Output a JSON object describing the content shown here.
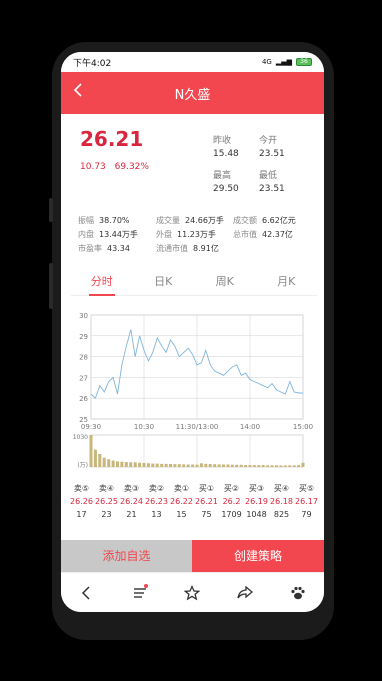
{
  "status_bar": {
    "time": "下午4:02",
    "network": "4G",
    "battery": "36"
  },
  "header": {
    "title": "N久盛",
    "back_icon": "chevron-left-icon"
  },
  "quote": {
    "price": "26.21",
    "change": "10.73",
    "change_pct": "69.32%",
    "prev_close_label": "昨收",
    "prev_close": "15.48",
    "open_label": "今开",
    "open": "23.51",
    "high_label": "最高",
    "high": "29.50",
    "low_label": "最低",
    "low": "23.51"
  },
  "stats": {
    "amplitude_label": "振幅",
    "amplitude": "38.70%",
    "volume_label": "成交量",
    "volume": "24.66万手",
    "turnover_label": "成交额",
    "turnover": "6.62亿元",
    "inner_label": "内盘",
    "inner": "13.44万手",
    "outer_label": "外盘",
    "outer": "11.23万手",
    "mktcap_label": "总市值",
    "mktcap": "42.37亿",
    "pe_label": "市盈率",
    "pe": "43.34",
    "float_cap_label": "流通市值",
    "float_cap": "8.91亿"
  },
  "tabs": [
    {
      "label": "分时",
      "active": true
    },
    {
      "label": "日K",
      "active": false
    },
    {
      "label": "周K",
      "active": false
    },
    {
      "label": "月K",
      "active": false
    }
  ],
  "chart_data": {
    "type": "line",
    "title": "",
    "xlabel": "",
    "ylabel": "",
    "x_ticks": [
      "09:30",
      "10:30",
      "11:30/13:00",
      "14:00",
      "15:00"
    ],
    "y_ticks": [
      "30",
      "29",
      "28",
      "27",
      "26",
      "25"
    ],
    "ylim": [
      25,
      30
    ],
    "x": [
      "09:30",
      "09:35",
      "09:40",
      "09:45",
      "09:50",
      "09:55",
      "10:00",
      "10:05",
      "10:10",
      "10:15",
      "10:20",
      "10:25",
      "10:30",
      "10:35",
      "10:40",
      "10:45",
      "10:50",
      "10:55",
      "11:00",
      "11:05",
      "11:10",
      "11:15",
      "11:20",
      "11:25",
      "11:30",
      "13:05",
      "13:10",
      "13:15",
      "13:20",
      "13:25",
      "13:30",
      "13:35",
      "13:40",
      "13:45",
      "13:50",
      "13:55",
      "14:00",
      "14:05",
      "14:10",
      "14:15",
      "14:20",
      "14:25",
      "14:30",
      "14:35",
      "14:40",
      "14:45",
      "14:50",
      "14:55",
      "15:00"
    ],
    "values": [
      26.2,
      26.0,
      26.6,
      26.3,
      26.8,
      27.0,
      26.2,
      27.6,
      28.5,
      29.3,
      28.0,
      29.0,
      28.3,
      27.8,
      28.2,
      28.9,
      28.5,
      28.2,
      28.8,
      28.5,
      28.0,
      28.2,
      28.4,
      28.1,
      27.6,
      27.7,
      28.3,
      27.6,
      27.3,
      27.2,
      27.1,
      27.3,
      27.5,
      27.6,
      27.1,
      27.2,
      26.9,
      26.8,
      26.7,
      26.6,
      26.5,
      26.7,
      26.4,
      26.3,
      26.2,
      26.8,
      26.3,
      26.25,
      26.25
    ],
    "volume": {
      "y_ticks": [
        "1030",
        "(万)"
      ],
      "ylim": [
        0,
        1030
      ],
      "values": [
        1030,
        560,
        420,
        300,
        250,
        210,
        180,
        170,
        160,
        150,
        150,
        140,
        130,
        120,
        110,
        110,
        100,
        100,
        95,
        90,
        90,
        85,
        80,
        80,
        75,
        120,
        100,
        95,
        90,
        85,
        80,
        80,
        75,
        70,
        70,
        65,
        65,
        60,
        60,
        60,
        55,
        55,
        55,
        50,
        50,
        50,
        55,
        60,
        140
      ]
    },
    "colors": {
      "line": "#7fb5da",
      "volume": "#c8b67a",
      "grid": "#d0d0d0"
    }
  },
  "orderbook": {
    "sell": [
      {
        "label": "卖⑤",
        "price": "26.26",
        "vol": "17"
      },
      {
        "label": "卖④",
        "price": "26.25",
        "vol": "23"
      },
      {
        "label": "卖③",
        "price": "26.24",
        "vol": "21"
      },
      {
        "label": "卖②",
        "price": "26.23",
        "vol": "13"
      },
      {
        "label": "卖①",
        "price": "26.22",
        "vol": "15"
      }
    ],
    "buy": [
      {
        "label": "买①",
        "price": "26.21",
        "vol": "75"
      },
      {
        "label": "买②",
        "price": "26.2",
        "vol": "1709"
      },
      {
        "label": "买③",
        "price": "26.19",
        "vol": "1048"
      },
      {
        "label": "买④",
        "price": "26.18",
        "vol": "825"
      },
      {
        "label": "买⑤",
        "price": "26.17",
        "vol": "79"
      }
    ]
  },
  "actions": {
    "add_watch": "添加自选",
    "create_strategy": "创建策略"
  },
  "nav": [
    "back-icon",
    "menu-icon",
    "star-icon",
    "share-icon",
    "paw-icon"
  ],
  "colors": {
    "brand": "#f2474f",
    "up": "#d7263d"
  }
}
